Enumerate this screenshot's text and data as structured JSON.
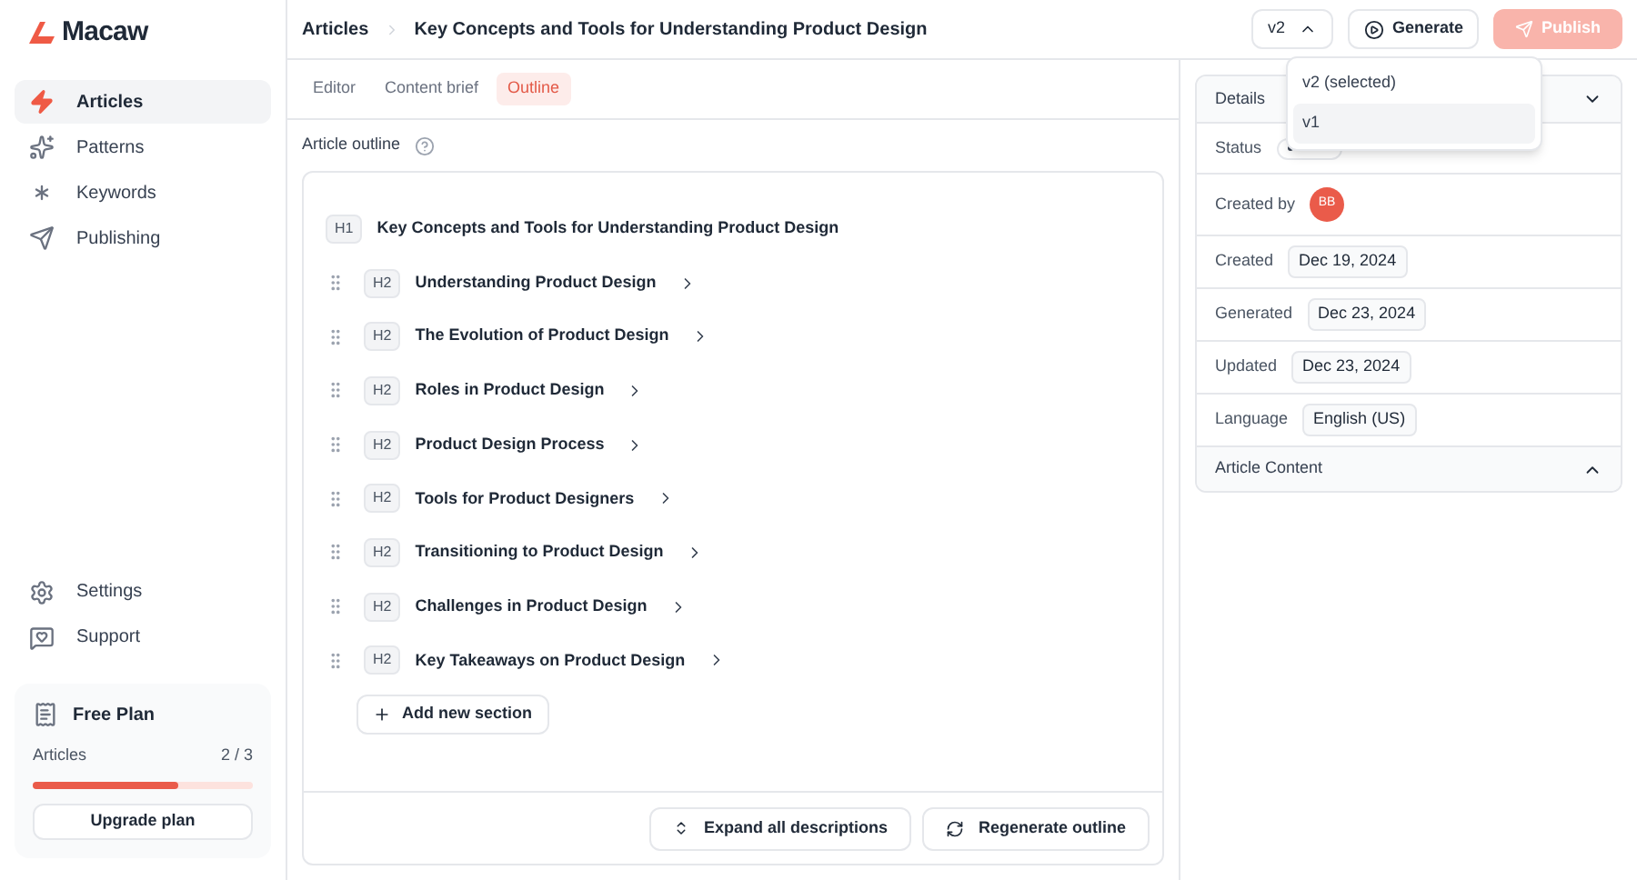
{
  "brand": "Macaw",
  "nav": [
    {
      "label": "Articles",
      "selected": true
    },
    {
      "label": "Patterns",
      "selected": false
    },
    {
      "label": "Keywords",
      "selected": false
    },
    {
      "label": "Publishing",
      "selected": false
    }
  ],
  "nav_bottom": [
    {
      "label": "Settings"
    },
    {
      "label": "Support"
    }
  ],
  "plan": {
    "title": "Free Plan",
    "label": "Articles",
    "count": "2 / 3",
    "level": 0.66,
    "button": "Upgrade plan"
  },
  "breadcrumb": [
    "Articles",
    "Key Concepts and Tools for Understanding Product Design"
  ],
  "version": {
    "label": "v2",
    "expanded": true,
    "options": [
      {
        "label": "v2 (selected)",
        "highlighted": false
      },
      {
        "label": "v1",
        "highlighted": true
      }
    ]
  },
  "generate_button": "Generate",
  "publish_button": {
    "label": "Publish",
    "disabled": true
  },
  "tabs": [
    {
      "label": "Editor",
      "selected": false
    },
    {
      "label": "Content brief",
      "selected": false
    },
    {
      "label": "Outline",
      "selected": true
    }
  ],
  "outline_label": "Article outline",
  "outline": [
    {
      "level": "H1",
      "title": "Key Concepts and Tools for Understanding Product Design"
    },
    {
      "level": "H2",
      "title": "Understanding Product Design"
    },
    {
      "level": "H2",
      "title": "The Evolution of Product Design"
    },
    {
      "level": "H2",
      "title": "Roles in Product Design"
    },
    {
      "level": "H2",
      "title": "Product Design Process"
    },
    {
      "level": "H2",
      "title": "Tools for Product Designers"
    },
    {
      "level": "H2",
      "title": "Transitioning to Product Design"
    },
    {
      "level": "H2",
      "title": "Challenges in Product Design"
    },
    {
      "level": "H2",
      "title": "Key Takeaways on Product Design"
    }
  ],
  "add_section": "Add new section",
  "footer_buttons": [
    "Expand all descriptions",
    "Regenerate outline"
  ],
  "details": {
    "title": "Details",
    "expanded": true,
    "rows": [
      {
        "label": "Status",
        "kind": "status"
      },
      {
        "label": "Created by",
        "kind": "avatar",
        "value": "BB"
      },
      {
        "label": "Created",
        "kind": "tag",
        "value": "Dec 19, 2024"
      },
      {
        "label": "Generated",
        "kind": "tag",
        "value": "Dec 23, 2024"
      },
      {
        "label": "Updated",
        "kind": "tag",
        "value": "Dec 23, 2024"
      },
      {
        "label": "Language",
        "kind": "tag",
        "value": "English (US)"
      }
    ]
  },
  "article_content": {
    "title": "Article Content",
    "expanded": false
  }
}
